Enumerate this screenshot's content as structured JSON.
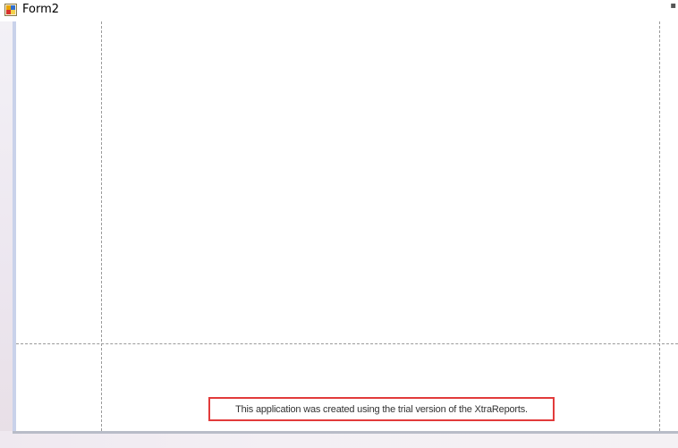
{
  "window": {
    "title": "Form2",
    "icon": "winforms-app-icon"
  },
  "report": {
    "trial_notice": "This application was created using the trial version of the XtraReports."
  },
  "colors": {
    "notice_border": "#e23b3b",
    "guide_line": "#9a9a9a",
    "frame_accent": "#c9d2ea"
  }
}
